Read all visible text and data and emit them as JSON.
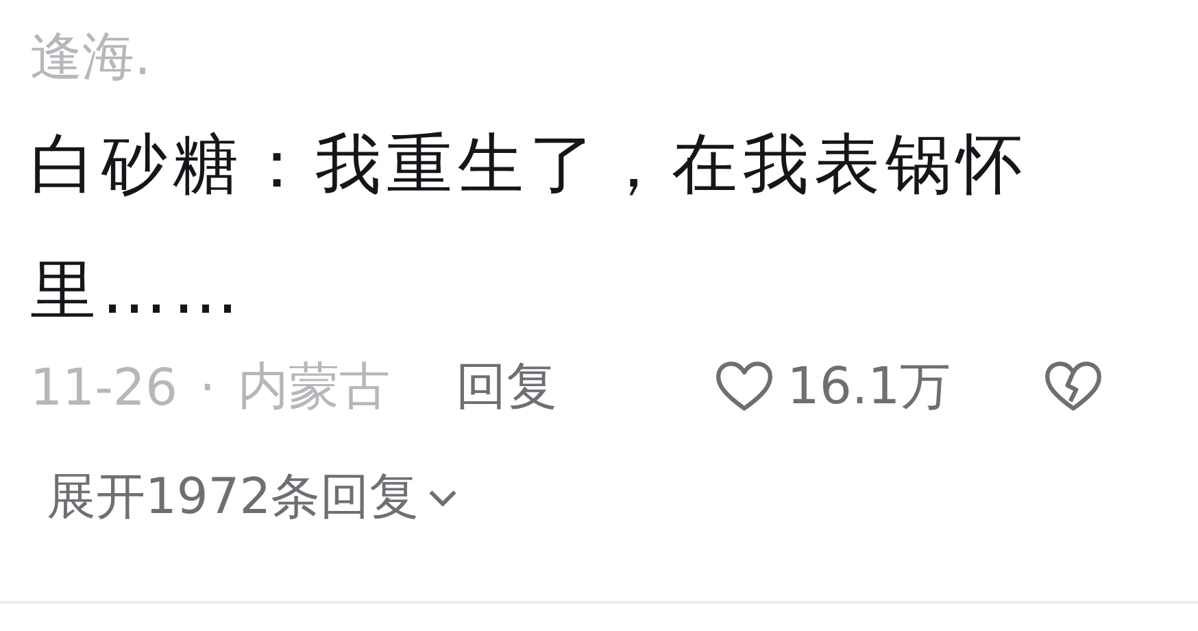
{
  "comment": {
    "author": "逢海.",
    "text": "白砂糖：我重生了，在我表锅怀里……",
    "date": "11-26",
    "separator": "·",
    "location": "内蒙古",
    "reply_label": "回复",
    "likes": "16.1万",
    "expand_label": "展开1972条回复"
  }
}
